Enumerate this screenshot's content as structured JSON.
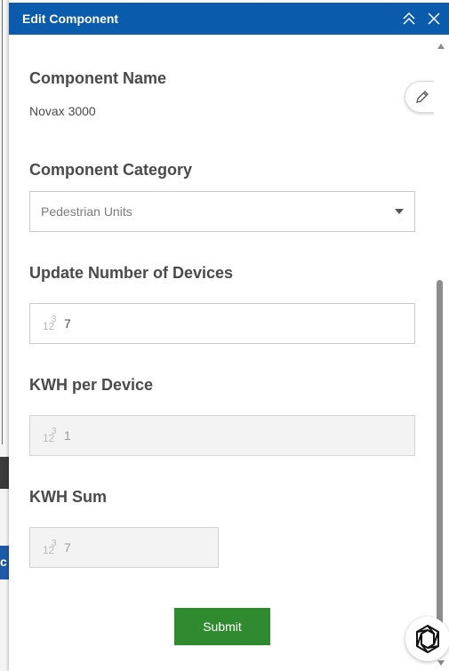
{
  "background": {
    "blue_strip_text": "c"
  },
  "panel": {
    "title": "Edit Component",
    "icons": {
      "collapse": "double-chevron-up-icon",
      "close": "close-icon",
      "edit": "pencil-icon"
    }
  },
  "form": {
    "component_name": {
      "label": "Component Name",
      "value": "Novax 3000"
    },
    "component_category": {
      "label": "Component Category",
      "selected": "Pedestrian Units"
    },
    "number_of_devices": {
      "label": "Update Number of Devices",
      "icon_text_a": "12",
      "icon_text_b": "3",
      "value": "7"
    },
    "kwh_per_device": {
      "label": "KWH per Device",
      "icon_text_a": "12",
      "icon_text_b": "3",
      "value": "1"
    },
    "kwh_sum": {
      "label": "KWH Sum",
      "icon_text_a": "12",
      "icon_text_b": "3",
      "value": "7"
    },
    "submit_label": "Submit"
  },
  "colors": {
    "header_bg": "#0a5bab",
    "submit_bg": "#2f8a30"
  }
}
